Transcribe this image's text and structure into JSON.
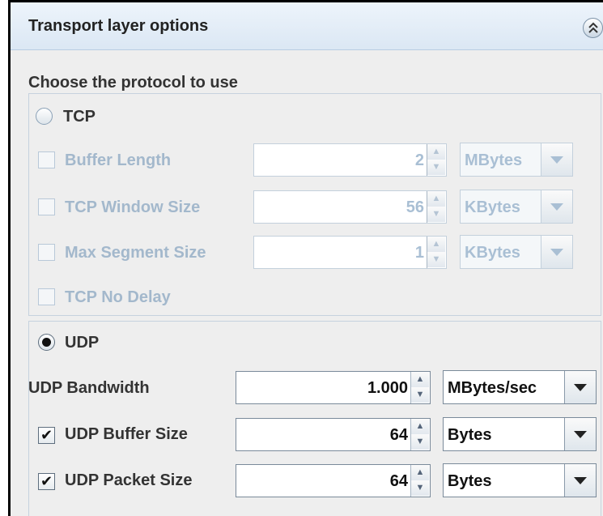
{
  "panel": {
    "title": "Transport layer options",
    "section_label": "Choose the protocol to use"
  },
  "tcp": {
    "label": "TCP",
    "selected": false,
    "buffer_length": {
      "label": "Buffer Length",
      "checked": false,
      "value": "2",
      "unit": "MBytes"
    },
    "window_size": {
      "label": "TCP Window Size",
      "checked": false,
      "value": "56",
      "unit": "KBytes"
    },
    "max_segment_size": {
      "label": "Max Segment Size",
      "checked": false,
      "value": "1",
      "unit": "KBytes"
    },
    "no_delay": {
      "label": "TCP No Delay",
      "checked": false
    }
  },
  "udp": {
    "label": "UDP",
    "selected": true,
    "bandwidth": {
      "label": "UDP Bandwidth",
      "value": "1.000",
      "unit": "MBytes/sec"
    },
    "buffer_size": {
      "label": "UDP Buffer Size",
      "checked": true,
      "value": "64",
      "unit": "Bytes"
    },
    "packet_size": {
      "label": "UDP Packet Size",
      "checked": true,
      "value": "64",
      "unit": "Bytes"
    }
  },
  "icons": {
    "collapse": "double-chevron-up-icon",
    "radio": "radio-icon",
    "checkbox": "checkbox-icon",
    "spinner_up": "spinner-up-icon",
    "spinner_down": "spinner-down-icon",
    "dropdown": "dropdown-arrow-icon",
    "check_mark": "✔"
  },
  "colors": {
    "header_bg": "#dbe7f4",
    "panel_bg": "#eeeeee",
    "disabled_text": "#a3b8cc",
    "enabled_text": "#333333"
  }
}
